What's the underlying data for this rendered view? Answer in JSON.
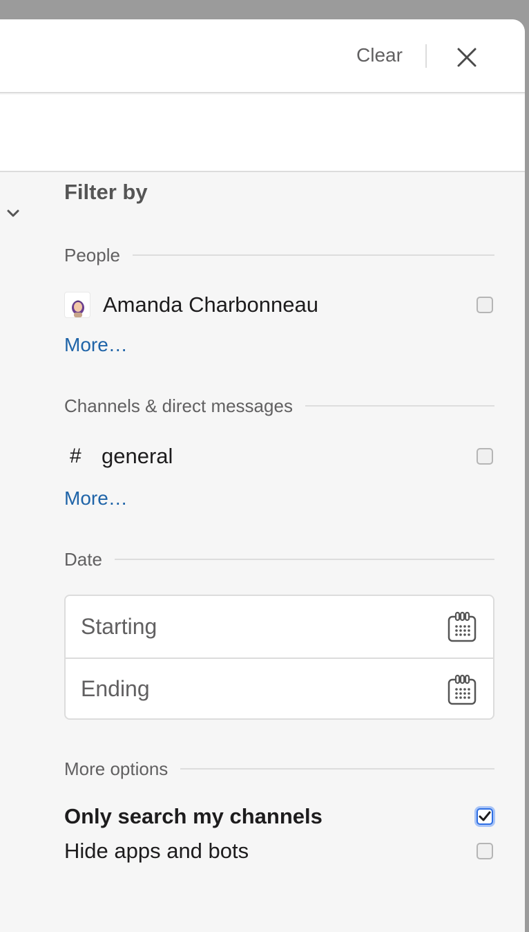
{
  "header": {
    "clear_label": "Clear"
  },
  "filter": {
    "title": "Filter by",
    "people": {
      "heading": "People",
      "items": [
        {
          "name": "Amanda Charbonneau",
          "checked": false
        }
      ],
      "more_label": "More…"
    },
    "channels": {
      "heading": "Channels & direct messages",
      "items": [
        {
          "prefix": "#",
          "name": "general",
          "checked": false
        }
      ],
      "more_label": "More…"
    },
    "date": {
      "heading": "Date",
      "starting_placeholder": "Starting",
      "ending_placeholder": "Ending"
    },
    "more_options": {
      "heading": "More options",
      "items": [
        {
          "label": "Only search my channels",
          "checked": true
        },
        {
          "label": "Hide apps and bots",
          "checked": false
        }
      ]
    }
  },
  "icons": {
    "close": "close-icon",
    "collapse": "chevron-down-icon",
    "calendar": "calendar-icon",
    "avatar": "avatar"
  },
  "colors": {
    "link": "#1f64a8",
    "checkbox_active": "#2f6fe4"
  }
}
